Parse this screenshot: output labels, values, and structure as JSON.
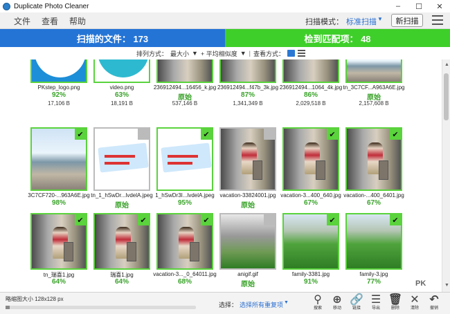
{
  "window": {
    "title": "Duplicate Photo Cleaner"
  },
  "menu": {
    "items": [
      "文件",
      "查看",
      "帮助"
    ],
    "scan_mode_label": "扫描模式：",
    "scan_mode_value": "标准扫描",
    "new_scan": "新扫描"
  },
  "summary": {
    "scanned": "扫描的文件： 173",
    "matched": "检到匹配项： 48"
  },
  "sortbar": {
    "sort_label": "排列方式：",
    "sort_value": "最大小",
    "sort_secondary": "+ 平均相似度",
    "view_label": "查看方式："
  },
  "grid": {
    "row0": [
      {
        "name": "PKstep_logo.png",
        "pct": "92%",
        "size": "17,106 B"
      },
      {
        "name": "video.png",
        "pct": "63%",
        "size": "18,191 B"
      },
      {
        "name": "236912494...16456_k.jpg",
        "pct": "原始",
        "size": "537,146 B"
      },
      {
        "name": "236912494...f47b_3k.jpg",
        "pct": "87%",
        "size": "1,341,349 B"
      },
      {
        "name": "236912494...1064_4k.jpg",
        "pct": "86%",
        "size": "2,029,518 B"
      },
      {
        "name": "tn_3C7CF...A963A6E.jpg",
        "pct": "原始",
        "size": "2,157,608 B"
      }
    ],
    "row1": [
      {
        "name": "3C7CF720-...963A6E.jpg",
        "pct": "98%",
        "size": "1,288,766 B"
      },
      {
        "name": "tn_1_hSwDr...lvdelA.jpeg",
        "pct": "原始",
        "size": "811,794 B"
      },
      {
        "name": "1_hSwDr3I...lvdelA.jpeg",
        "pct": "95%",
        "size": "437,154 B"
      },
      {
        "name": "vacation-33824001.jpg",
        "pct": "原始",
        "size": "78,449 B"
      },
      {
        "name": "vacation-3...400_640.jpg",
        "pct": "67%",
        "size": "88,714 B"
      },
      {
        "name": "vacation-...400_6401.jpg",
        "pct": "67%",
        "size": "189,165 B"
      }
    ],
    "row2": [
      {
        "name": "tn_瑞喜1.jpg",
        "pct": "64%",
        "size": "103,000 B"
      },
      {
        "name": "瑞喜1.jpg",
        "pct": "64%",
        "size": "88,889 B"
      },
      {
        "name": "vacation-3..._0_64011.jpg",
        "pct": "68%",
        "size": "608,189 B"
      },
      {
        "name": "anigif.gif",
        "pct": "原始",
        "size": "265,245 B"
      },
      {
        "name": "family-3381.jpg",
        "pct": "91%",
        "size": "192,200 B"
      },
      {
        "name": "family-3.jpg",
        "pct": "77%",
        "size": "26,139 B"
      }
    ]
  },
  "banner_text": {
    "line1": "社交成功的",
    "line2": "購購介紹"
  },
  "watermark": "PK",
  "statusbar": {
    "thumb_size": "略缩图大小 128x128 px",
    "select_label": "选择：",
    "select_value": "选择所有重复项",
    "tools": [
      "搜索",
      "移动",
      "链接",
      "导出",
      "删除",
      "清除",
      "撤销"
    ]
  },
  "colors": {
    "blue": "#2474d6",
    "green": "#3fcf2a",
    "match": "#5ad33c"
  }
}
